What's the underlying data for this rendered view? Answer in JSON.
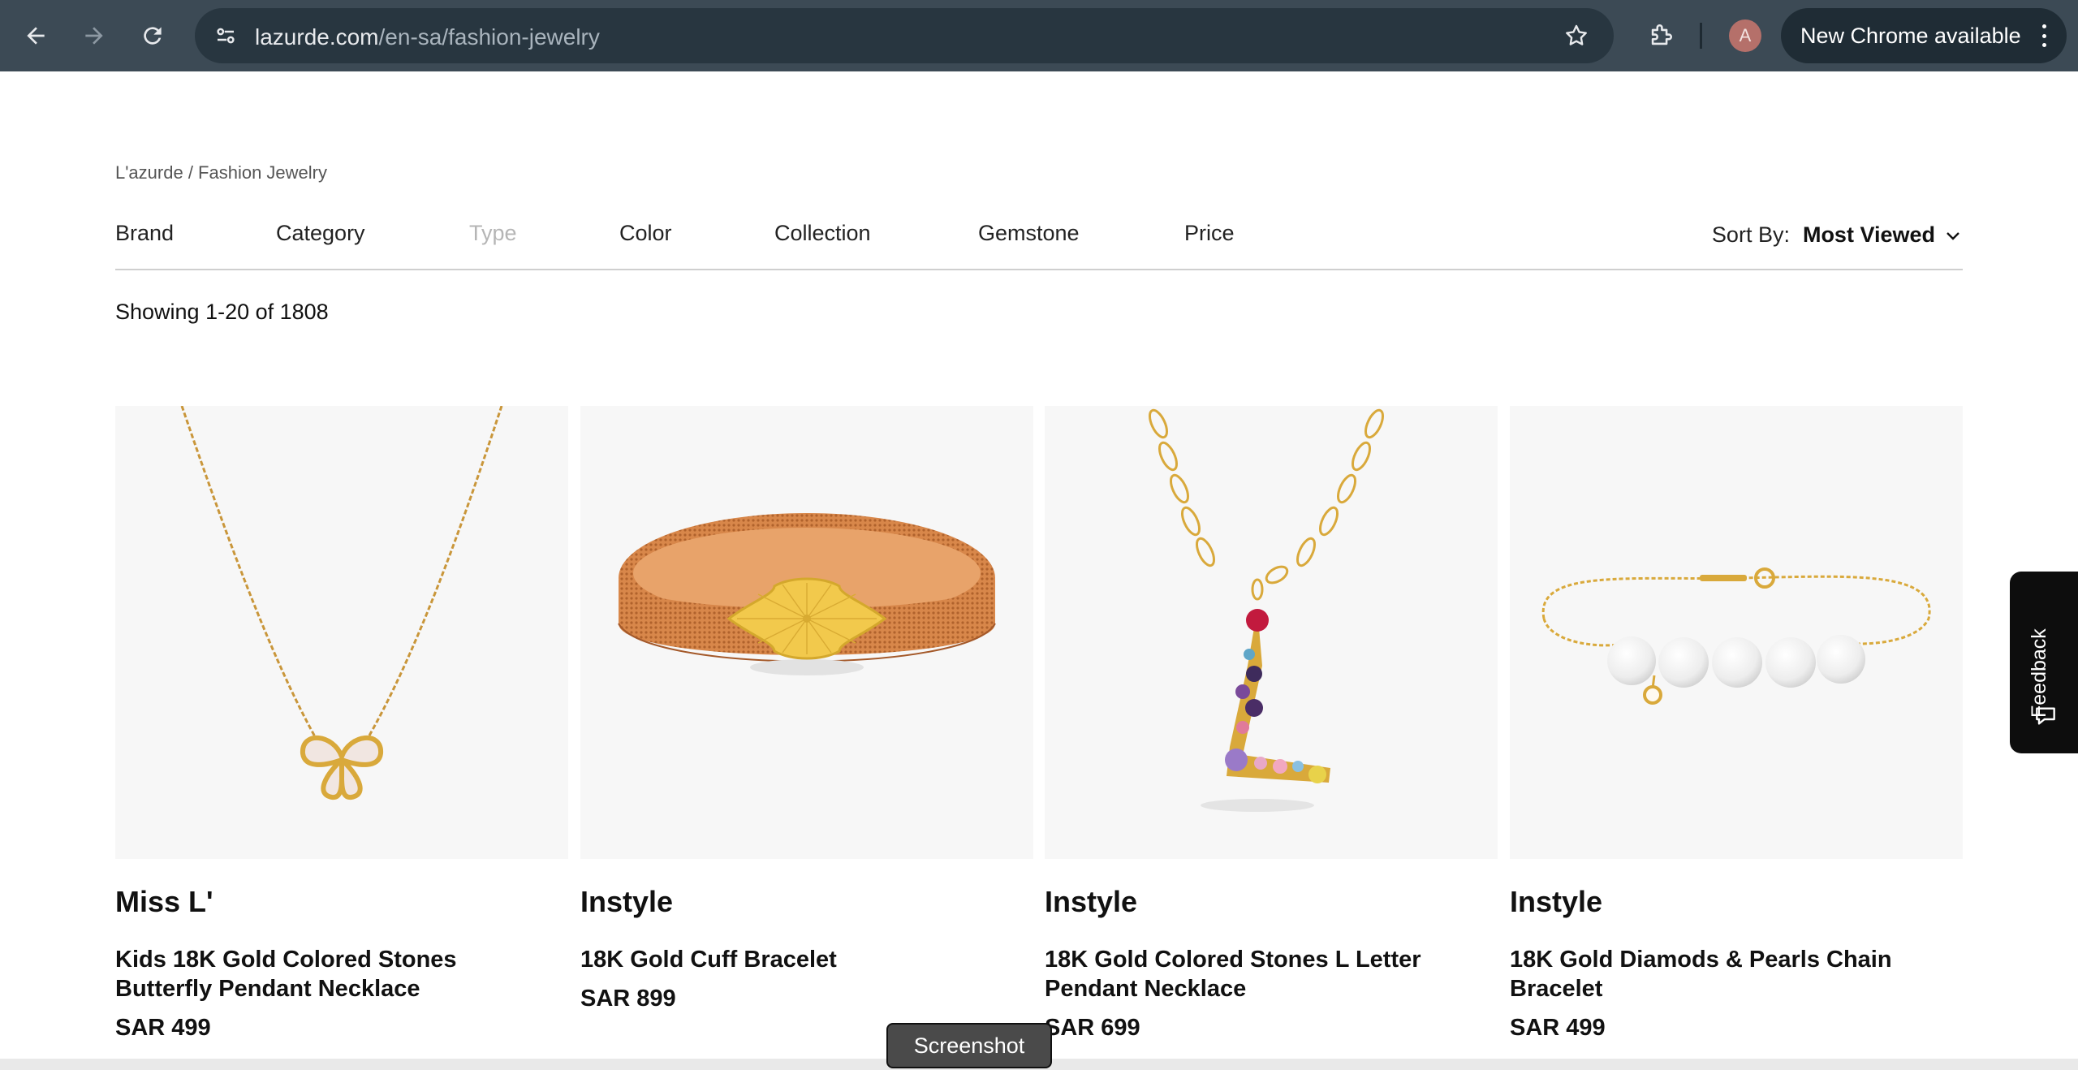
{
  "browser": {
    "url_host": "lazurde.com",
    "url_path": "/en-sa/fashion-jewelry",
    "avatar_initial": "A",
    "update_label": "New Chrome available"
  },
  "page": {
    "breadcrumb": "L'azurde / Fashion Jewelry",
    "filters": [
      "Brand",
      "Category",
      "Type",
      "Color",
      "Collection",
      "Gemstone",
      "Price"
    ],
    "disabled_filter": "Type",
    "sort_label": "Sort By:",
    "sort_value": "Most Viewed",
    "result_count": "Showing 1-20 of 1808",
    "products": [
      {
        "brand": "Miss L'",
        "name": "Kids 18K Gold Colored Stones Butterfly Pendant Necklace",
        "price": "SAR 499",
        "image": "butterfly-necklace"
      },
      {
        "brand": "Instyle",
        "name": "18K Gold Cuff Bracelet",
        "price": "SAR 899",
        "image": "mesh-cuff-bracelet"
      },
      {
        "brand": "Instyle",
        "name": "18K Gold Colored Stones L Letter Pendant Necklace",
        "price": "SAR 699",
        "image": "letter-l-necklace"
      },
      {
        "brand": "Instyle",
        "name": "18K Gold Diamods & Pearls Chain Bracelet",
        "price": "SAR 499",
        "image": "pearl-chain-bracelet"
      }
    ],
    "feedback_label": "Feedback",
    "tooltip": "Screenshot"
  },
  "colors": {
    "chrome_bg": "#3c4a55",
    "gold": "#d9a93b",
    "card_bg": "#f7f7f7"
  }
}
